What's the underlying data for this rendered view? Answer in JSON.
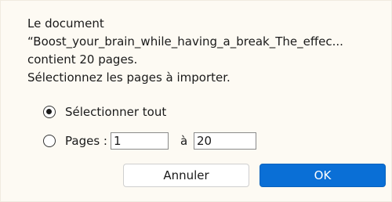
{
  "message": {
    "line1": "Le document",
    "line2": "“Boost_your_brain_while_having_a_break_The_effec...",
    "line3": "contient 20 pages.",
    "line4": "Sélectionnez les pages à importer."
  },
  "options": {
    "select_all": {
      "label": "Sélectionner tout",
      "checked": true
    },
    "pages": {
      "label": "Pages :",
      "checked": false,
      "from_value": "1",
      "to_label": "à",
      "to_value": "20"
    }
  },
  "buttons": {
    "cancel_label": "Annuler",
    "ok_label": "OK"
  },
  "colors": {
    "background": "#fdfaf3",
    "primary": "#0a6fd6"
  }
}
